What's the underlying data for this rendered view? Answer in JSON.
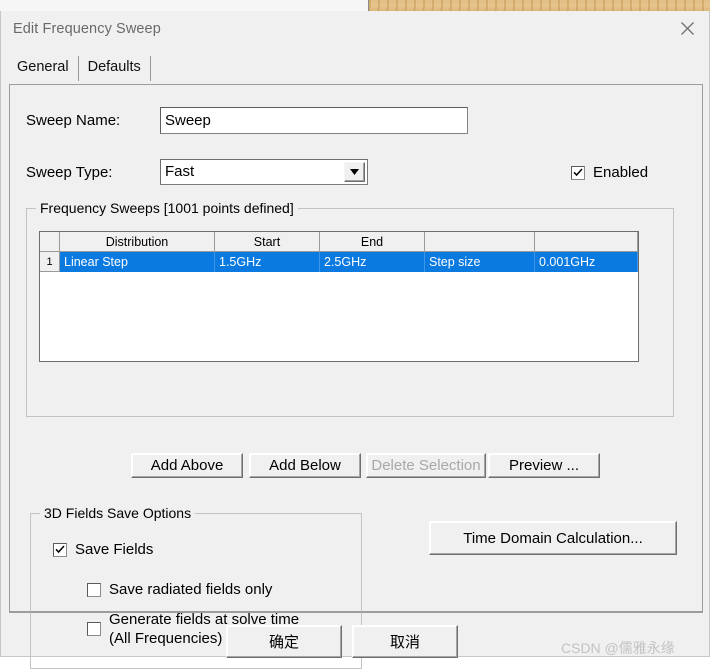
{
  "background": {
    "app_strip": "visible"
  },
  "window": {
    "title": "Edit Frequency Sweep",
    "close_icon": "close-icon"
  },
  "tabs": [
    {
      "label": "General",
      "selected": true
    },
    {
      "label": "Defaults",
      "selected": false
    }
  ],
  "form": {
    "sweep_name_label": "Sweep Name:",
    "sweep_name_value": "Sweep",
    "sweep_type_label": "Sweep Type:",
    "sweep_type_value": "Fast",
    "dropdown_icon": "chevron-down-icon",
    "enabled_label": "Enabled",
    "enabled_checked": true
  },
  "frequency_sweeps": {
    "group_title": "Frequency Sweeps [1001 points defined]",
    "columns": [
      "",
      "Distribution",
      "Start",
      "End",
      "",
      ""
    ],
    "rows": [
      {
        "number": "1",
        "distribution": "Linear Step",
        "start": "1.5GHz",
        "end": "2.5GHz",
        "extra_label": "Step size",
        "extra_value": "0.001GHz",
        "selected": true
      }
    ],
    "buttons": {
      "add_above": "Add Above",
      "add_below": "Add Below",
      "delete_selection": "Delete Selection",
      "delete_selection_enabled": false,
      "preview": "Preview ..."
    }
  },
  "fields_save_options": {
    "group_title": "3D Fields Save Options",
    "save_fields_label": "Save Fields",
    "save_fields_checked": true,
    "save_radiated_label": "Save radiated fields only",
    "save_radiated_checked": false,
    "generate_fields_label": "Generate fields at solve time\n(All Frequencies)",
    "generate_fields_checked": false
  },
  "side_actions": {
    "time_domain": "Time Domain Calculation..."
  },
  "footer": {
    "ok": "确定",
    "cancel": "取消"
  },
  "watermark": "CSDN @儒雅永缘",
  "colors": {
    "selection_blue": "#0a7ae0",
    "dialog_face": "#f0f0f0",
    "title_text": "#6a6a6a",
    "disabled_text": "#a8a8a8",
    "watermark": "#c3c3c3"
  }
}
